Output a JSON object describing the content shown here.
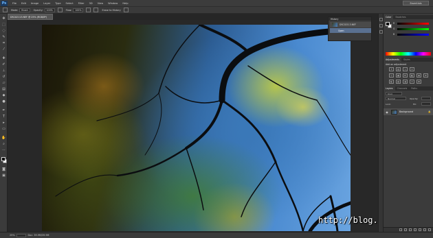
{
  "app": {
    "logo_text": "Ps",
    "workspace": "Essentials"
  },
  "menu": {
    "items": [
      "File",
      "Edit",
      "Image",
      "Layer",
      "Type",
      "Select",
      "Filter",
      "3D",
      "View",
      "Window",
      "Help"
    ]
  },
  "options": {
    "mode_label": "Mode:",
    "mode_value": "Brush",
    "opacity_label": "Opacity:",
    "opacity_value": "100%",
    "flow_label": "Flow:",
    "flow_value": "100%",
    "erase_history_label": "Erase to History"
  },
  "document": {
    "tab_title": "DSC02113.NEF @ 25% (RGB/8*)"
  },
  "history_panel": {
    "title": "History",
    "snapshot_label": "DSC02113.NEF",
    "step_label": "Open"
  },
  "color_panel": {
    "tabs": [
      "Color",
      "Swatches"
    ],
    "channels": [
      "R",
      "G",
      "B"
    ]
  },
  "adjustments_panel": {
    "tabs": [
      "Adjustments",
      "Styles"
    ],
    "title": "Add an adjustment"
  },
  "layers_panel": {
    "tabs": [
      "Layers",
      "Channels",
      "Paths"
    ],
    "kind_label": "Kind",
    "blend_mode": "Normal",
    "opacity_label": "Opacity:",
    "lock_label": "Lock:",
    "fill_label": "Fill:",
    "layer_name": "Background",
    "lock_icon": "lock-icon"
  },
  "status": {
    "zoom": "25%",
    "doc_info": "Doc: 39.9M/39.9M"
  },
  "watermark": {
    "text": "http://blog.arinae.net"
  },
  "colors": {
    "foreground": "#000000",
    "background": "#ffffff",
    "accent": "#5a7090"
  }
}
